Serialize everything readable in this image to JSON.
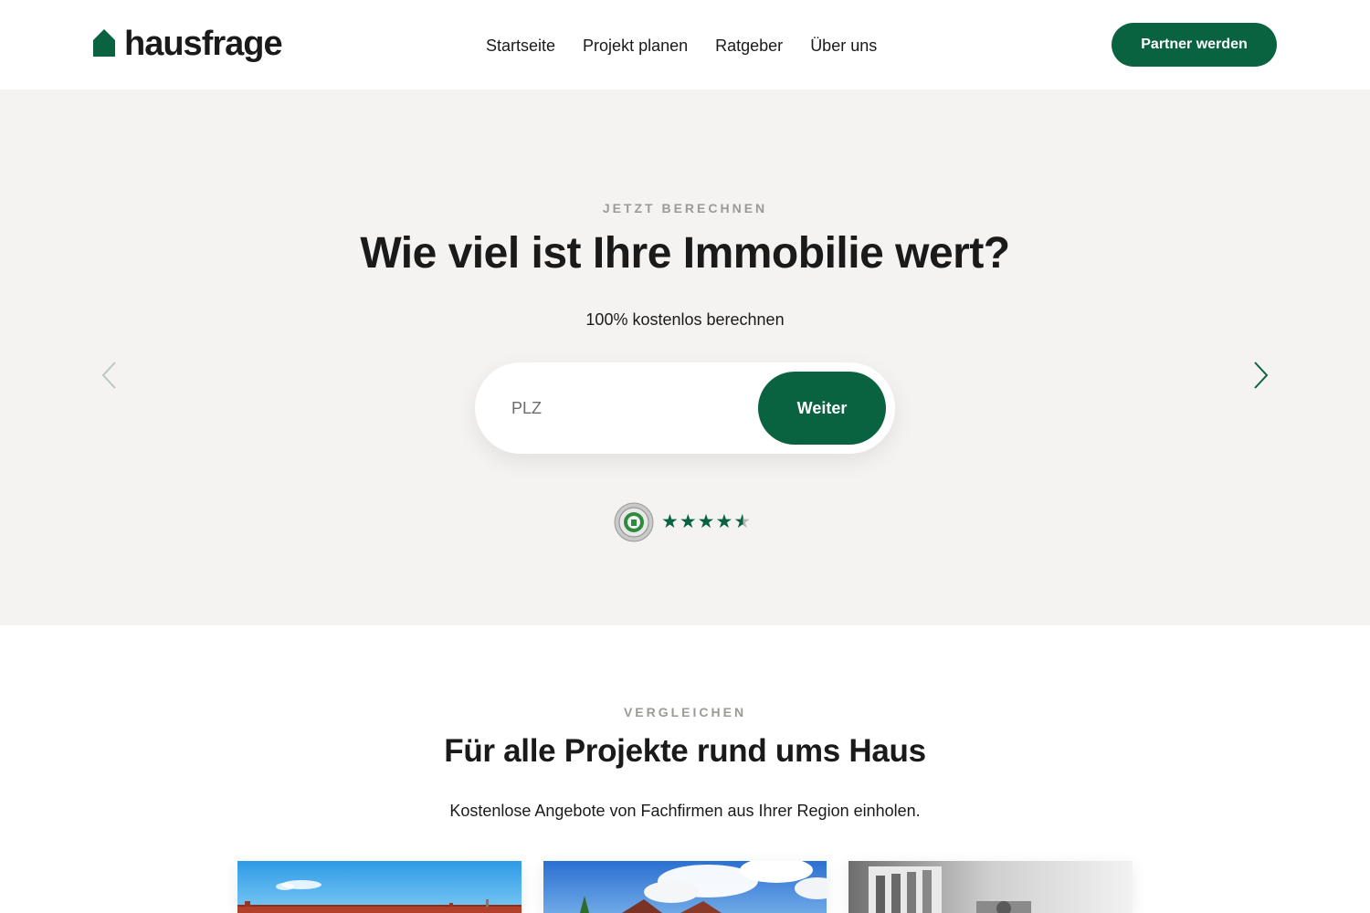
{
  "header": {
    "logo_text": "hausfrage",
    "nav": [
      "Startseite",
      "Projekt planen",
      "Ratgeber",
      "Über uns"
    ],
    "cta_label": "Partner werden"
  },
  "hero": {
    "eyebrow": "JETZT BERECHNEN",
    "title": "Wie viel ist Ihre Immobilie wert?",
    "subtitle": "100% kostenlos berechnen",
    "plz_placeholder": "PLZ",
    "plz_value": "",
    "submit_label": "Weiter",
    "rating_stars": 4.5,
    "rating_max": 5
  },
  "projects": {
    "eyebrow": "VERGLEICHEN",
    "title": "Für alle Projekte rund ums Haus",
    "subtitle": "Kostenlose Angebote von Fachfirmen aus Ihrer Region einholen."
  },
  "colors": {
    "brand_green": "#0a6340",
    "hero_bg": "#f5f3f1",
    "eyebrow_gray": "#9a9a96"
  }
}
